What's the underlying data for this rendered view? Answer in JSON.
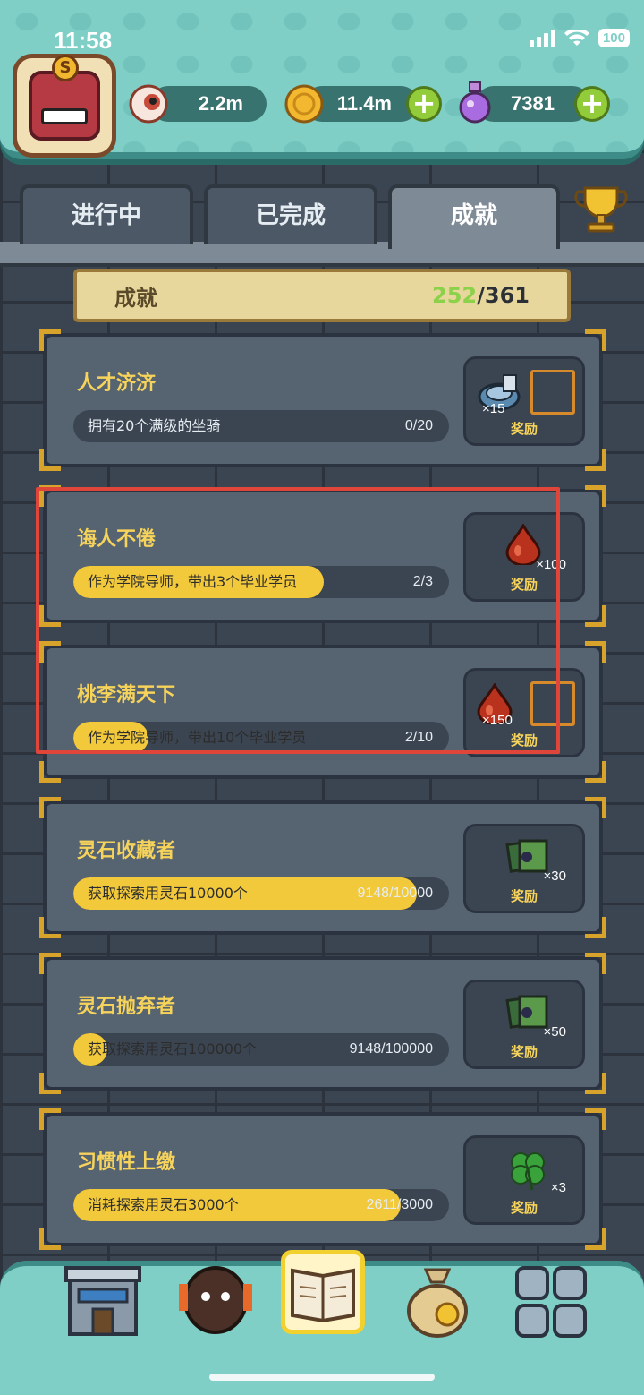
{
  "status_bar": {
    "time": "11:58",
    "battery": "100"
  },
  "resources": [
    {
      "icon": "eye-icon",
      "value": "2.2m"
    },
    {
      "icon": "coin-icon",
      "value": "11.4m"
    },
    {
      "icon": "potion-icon",
      "value": "7381"
    }
  ],
  "tabs": [
    {
      "label": "进行中",
      "active": false
    },
    {
      "label": "已完成",
      "active": false
    },
    {
      "label": "成就",
      "active": true
    }
  ],
  "summary": {
    "label": "成就",
    "current": "252",
    "separator": "/",
    "total": "361"
  },
  "achievements": [
    {
      "title": "人才济济",
      "desc": "拥有20个满级的坐骑",
      "progress": "0/20",
      "fraction": 0.0,
      "reward_icon": "carousel-icon",
      "reward_qty": "×15",
      "reward_label": "奖励",
      "extra_slot": true
    },
    {
      "title": "诲人不倦",
      "desc": "作为学院导师，带出3个毕业学员",
      "progress": "2/3",
      "fraction": 0.6667,
      "reward_icon": "drop-icon",
      "reward_qty": "×100",
      "reward_label": "奖励",
      "extra_slot": false
    },
    {
      "title": "桃李满天下",
      "desc": "作为学院导师，带出10个毕业学员",
      "progress": "2/10",
      "fraction": 0.2,
      "reward_icon": "drop-icon",
      "reward_qty": "×150",
      "reward_label": "奖励",
      "extra_slot": true
    },
    {
      "title": "灵石收藏者",
      "desc": "获取探索用灵石10000个",
      "progress": "9148/10000",
      "fraction": 0.9148,
      "reward_icon": "map-icon",
      "reward_qty": "×30",
      "reward_label": "奖励",
      "extra_slot": false
    },
    {
      "title": "灵石抛弃者",
      "desc": "获取探索用灵石100000个",
      "progress": "9148/100000",
      "fraction": 0.09148,
      "reward_icon": "map-icon",
      "reward_qty": "×50",
      "reward_label": "奖励",
      "extra_slot": false
    },
    {
      "title": "习惯性上缴",
      "desc": "消耗探索用灵石3000个",
      "progress": "2611/3000",
      "fraction": 0.8703,
      "reward_icon": "clover-icon",
      "reward_qty": "×3",
      "reward_label": "奖励",
      "extra_slot": false
    }
  ],
  "bottom_nav": [
    {
      "icon": "building-icon",
      "active": false
    },
    {
      "icon": "monster-icon",
      "active": false
    },
    {
      "icon": "book-icon",
      "active": true
    },
    {
      "icon": "money-bag-icon",
      "active": false
    },
    {
      "icon": "grid-icon",
      "active": false
    }
  ],
  "colors": {
    "accent_yellow": "#f2c93b",
    "teal": "#7fcfc7",
    "highlight_red": "#e0453a",
    "progress_green": "#8bd14a"
  }
}
